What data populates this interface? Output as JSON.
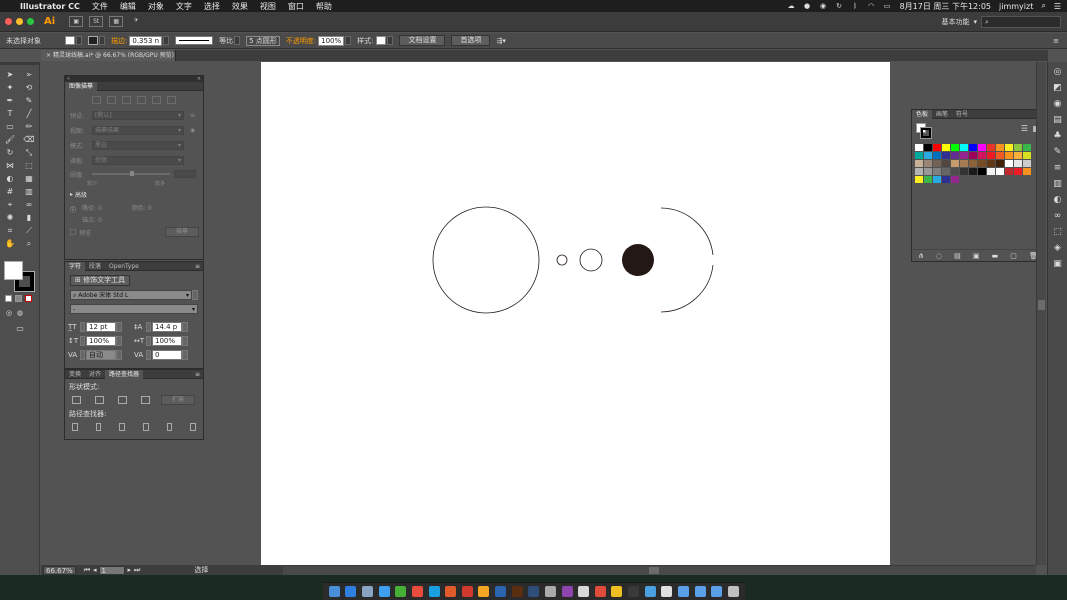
{
  "menubar": {
    "app_name": "Illustrator CC",
    "menus": [
      "文件",
      "编辑",
      "对象",
      "文字",
      "选择",
      "效果",
      "视图",
      "窗口",
      "帮助"
    ],
    "datetime": "8月17日 周三 下午12:05",
    "user": "jimmyizt"
  },
  "appbar": {
    "logo": "Ai",
    "workspace": "基本功能",
    "search_placeholder": ""
  },
  "control": {
    "selection_status": "未选择对象",
    "stroke_label": "描边:",
    "stroke_value": "0.353 n",
    "stroke_profile": "等比",
    "brush": "5 点圆形",
    "opacity_label": "不透明度:",
    "opacity_value": "100%",
    "style_label": "样式:",
    "doc_setup": "文档设置",
    "preferences": "首选项"
  },
  "document_tab": {
    "title": "精灵球线稿.ai* @ 66.67% (RGB/GPU 预览)"
  },
  "image_trace_panel": {
    "title": "图像描摹",
    "preset_label": "预设:",
    "preset_value": "[默认]",
    "view_label": "视图:",
    "view_value": "描摹结果",
    "mode_label": "模式:",
    "mode_value": "黑白",
    "palette_label": "调板:",
    "palette_value": "受限",
    "threshold_label": "阈值:",
    "less": "较少",
    "more": "较多",
    "advanced": "高级",
    "paths_label": "路径: 0",
    "colors_label": "颜色: 0",
    "anchors_label": "锚点: 0",
    "preview_label": "预览",
    "trace_button": "描摹"
  },
  "character_panel": {
    "tabs": [
      "字符",
      "段落",
      "OpenType"
    ],
    "touch_tool": "修饰文字工具",
    "font_family": "Adobe 宋体 Std L",
    "font_style": "-",
    "font_size": "12 pt",
    "leading": "14.4 p",
    "vscale": "100%",
    "hscale": "100%",
    "kerning": "自动",
    "tracking": "0"
  },
  "pathfinder_panel": {
    "tabs": [
      "变换",
      "对齐",
      "路径查找器"
    ],
    "shape_modes": "形状模式:",
    "expand": "扩展",
    "pathfinders": "路径查找器:"
  },
  "swatches_panel": {
    "tabs": [
      "色板",
      "画笔",
      "符号"
    ]
  },
  "statusbar": {
    "zoom": "66.67%",
    "page": "1",
    "status": "选择"
  },
  "swatch_colors": [
    "#ffffff",
    "#000000",
    "#ff0000",
    "#ffff00",
    "#00ff00",
    "#00ffff",
    "#0000ff",
    "#ff00ff",
    "#e8362a",
    "#f7931e",
    "#fcee21",
    "#8cc63f",
    "#39b54a",
    "#00a99d",
    "#29abe2",
    "#0071bc",
    "#2e3192",
    "#662d91",
    "#93278f",
    "#9e005d",
    "#d4145a",
    "#ed1c24",
    "#f15a24",
    "#f7931e",
    "#fbb03b",
    "#d9e021",
    "#c7b299",
    "#998675",
    "#736357",
    "#534741",
    "#c69c6d",
    "#a67c52",
    "#8c6239",
    "#754c24",
    "#603813",
    "#42210b",
    "#ffffff",
    "#e6e6e6",
    "#cccccc",
    "#b3b3b3",
    "#999999",
    "#808080",
    "#666666",
    "#4d4d4d",
    "#333333",
    "#1a1a1a",
    "#000000",
    "#f2f2f2",
    "#ffffff",
    "#c1272d",
    "#ed1c24",
    "#f7931e",
    "#fcee21",
    "#39b54a",
    "#29abe2",
    "#2e3192",
    "#93278f"
  ],
  "artwork": {
    "filled_circle_color": "#231815",
    "stroke_color": "#231815"
  }
}
